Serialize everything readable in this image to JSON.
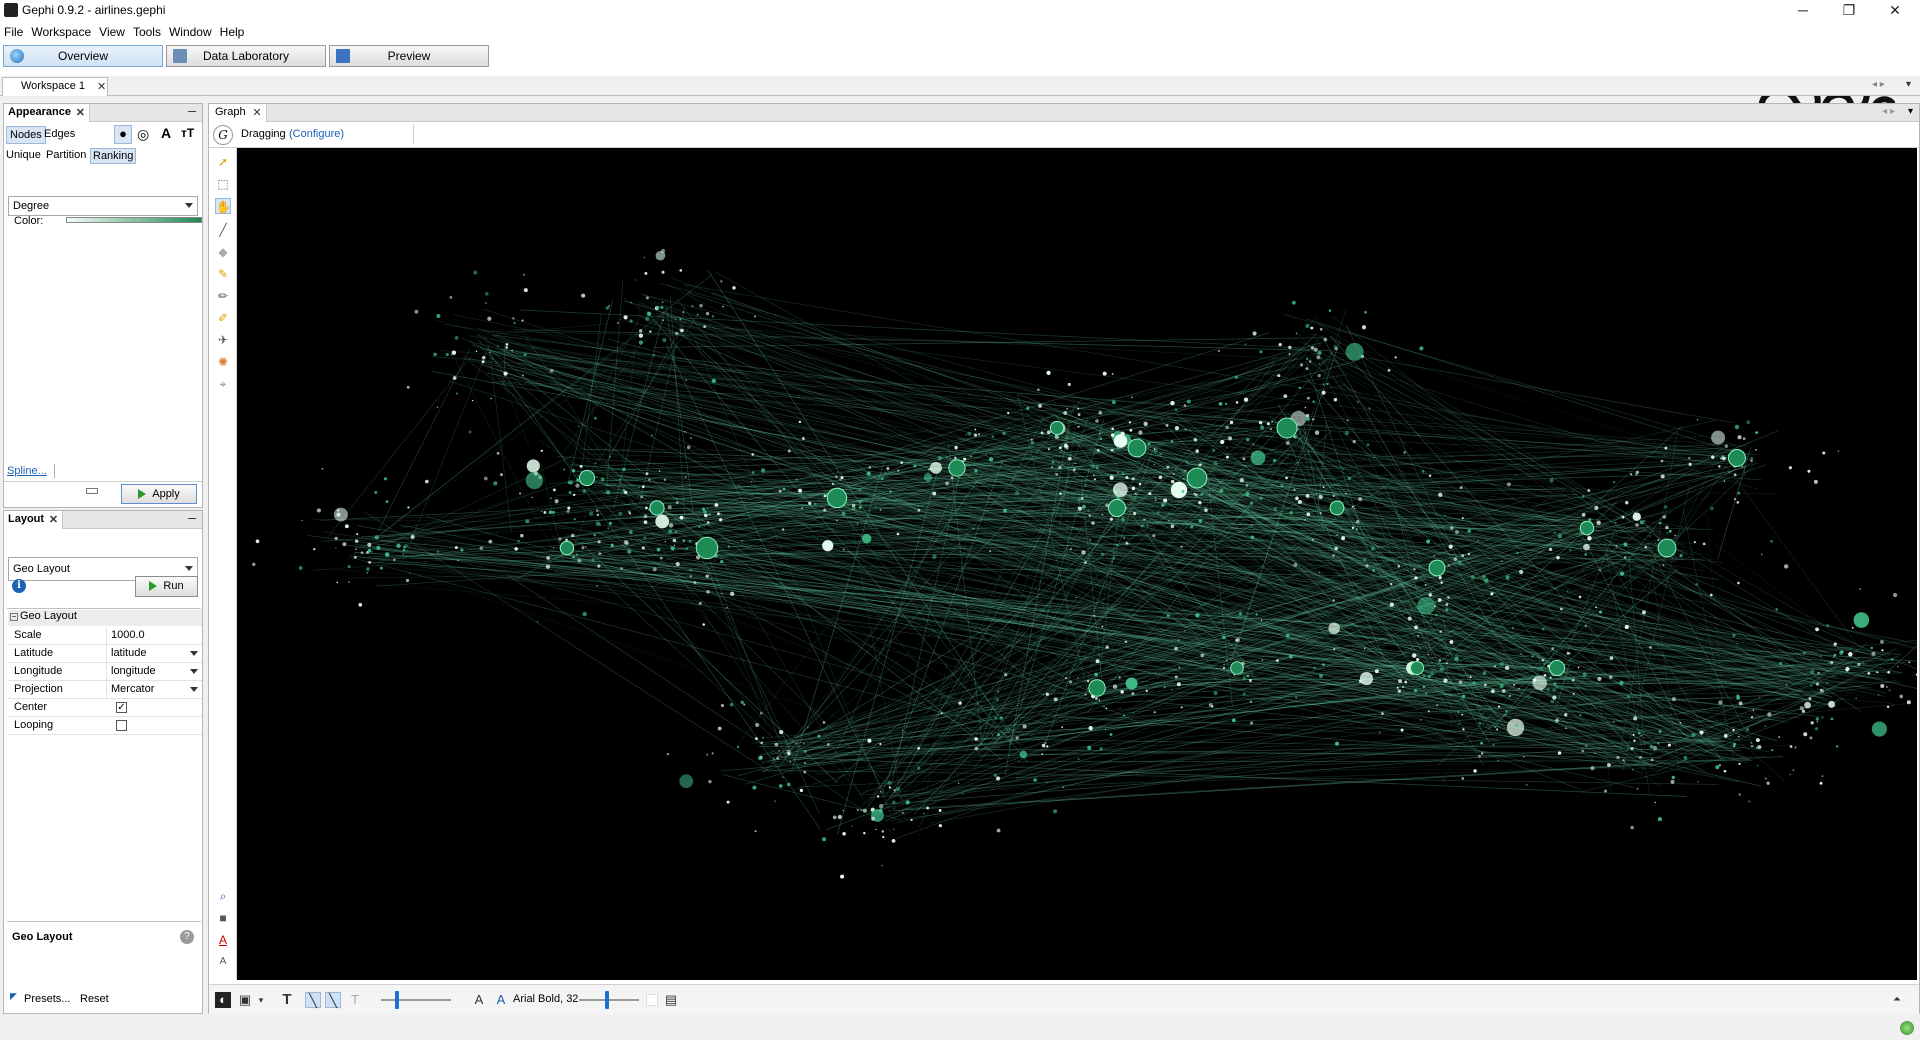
{
  "window": {
    "title": "Gephi 0.9.2 - airlines.gephi",
    "minimize": "─",
    "restore": "❐",
    "close": "✕"
  },
  "menu": [
    "File",
    "Workspace",
    "View",
    "Tools",
    "Window",
    "Help"
  ],
  "modes": {
    "overview": "Overview",
    "data_laboratory": "Data Laboratory",
    "preview": "Preview"
  },
  "workspace_tab": "Workspace 1",
  "appearance": {
    "title": "Appearance",
    "nodes_tab": "Nodes",
    "edges_tab": "Edges",
    "subtabs": [
      "Unique",
      "Partition",
      "Ranking"
    ],
    "attribute": "Degree",
    "color_label": "Color:",
    "spline_link": "Spline...",
    "apply_button": "Apply",
    "gradient_from": "#f4fbf6",
    "gradient_to": "#1e8a55"
  },
  "layout": {
    "title": "Layout",
    "algorithm": "Geo Layout",
    "run_button": "Run",
    "section": "Geo Layout",
    "properties": [
      {
        "key": "Scale",
        "value": "1000.0"
      },
      {
        "key": "Latitude",
        "value": "latitude"
      },
      {
        "key": "Longitude",
        "value": "longitude"
      },
      {
        "key": "Projection",
        "value": "Mercator"
      },
      {
        "key": "Center",
        "value": "checked"
      },
      {
        "key": "Looping",
        "value": "unchecked"
      }
    ],
    "description_title": "Geo Layout",
    "presets": "Presets...",
    "reset": "Reset"
  },
  "graph": {
    "tab": "Graph",
    "mode_label": "Dragging",
    "configure_link": "(Configure)",
    "font_label": "Arial Bold, 32",
    "background": "#000000",
    "edge_color": "#6fe0b4",
    "node_color": "#3fbf8a"
  }
}
